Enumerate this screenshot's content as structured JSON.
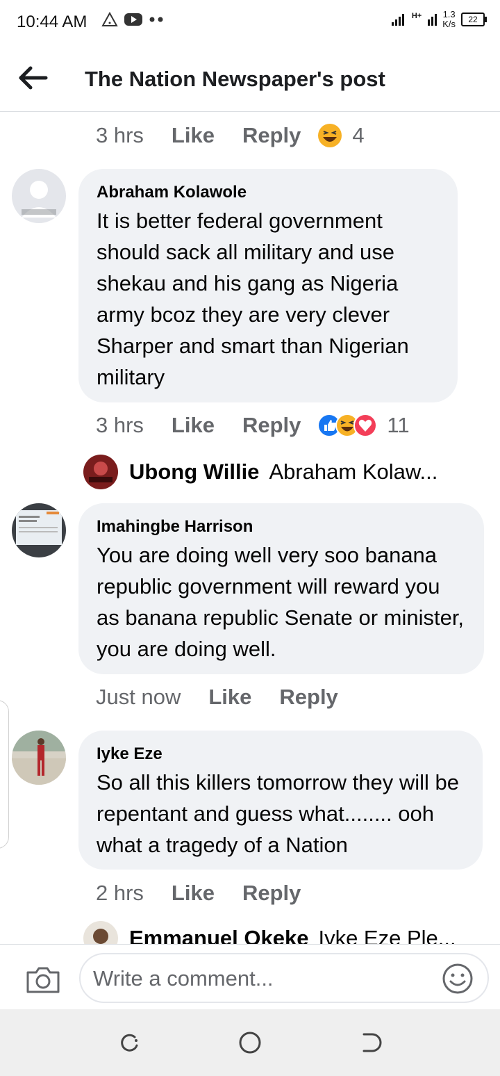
{
  "status_bar": {
    "time": "10:44 AM",
    "network_speed_value": "1.3",
    "network_speed_unit": "K/s",
    "signal_type": "H+",
    "battery": "22"
  },
  "header": {
    "title": "The Nation Newspaper's post"
  },
  "feed": {
    "top_action_row": {
      "time": "3 hrs",
      "like": "Like",
      "reply": "Reply",
      "reaction_count": "4"
    },
    "comments": [
      {
        "author": "Abraham Kolawole",
        "text": "It is better federal government should sack all military and use shekau and his gang as Nigeria army bcoz they are very clever Sharper and smart than Nigerian military",
        "time": "3 hrs",
        "like": "Like",
        "reply": "Reply",
        "reaction_count": "11",
        "reply_preview": {
          "name": "Ubong Willie",
          "snippet": "Abraham Kolaw..."
        }
      },
      {
        "author": "Imahingbe Harrison",
        "text": "You are doing well very soo banana republic government will reward you as banana republic Senate or minister, you are doing well.",
        "time": "Just now",
        "like": "Like",
        "reply": "Reply"
      },
      {
        "author": "Iyke Eze",
        "text": "So all this killers tomorrow they will be repentant and guess what........ ooh what a tragedy of a Nation",
        "time": "2 hrs",
        "like": "Like",
        "reply": "Reply",
        "reply_preview": {
          "name": "Emmanuel Okeke",
          "snippet": "Iyke Eze Ple..."
        }
      }
    ]
  },
  "composer": {
    "placeholder": "Write a comment..."
  },
  "colors": {
    "bubble": "#f0f2f5",
    "secondary_text": "#65676b",
    "like_blue": "#1877f2",
    "haha_yellow": "#f7b125",
    "love_red": "#f33e58"
  }
}
